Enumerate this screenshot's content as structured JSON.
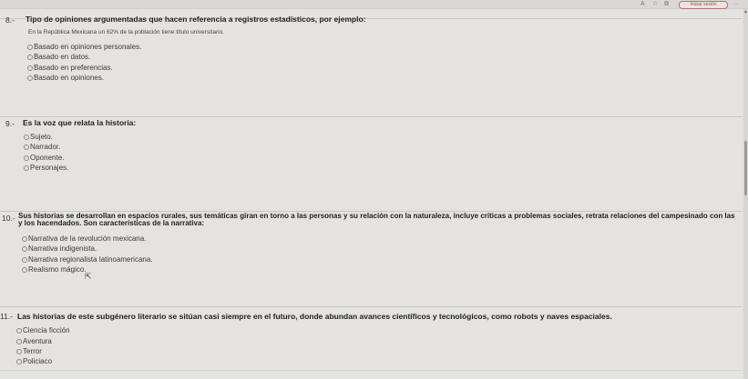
{
  "toolbar": {
    "pill_label": "Iniciar sesión",
    "icons": [
      "text-size-icon",
      "favorite-icon",
      "extension-icon",
      "profile-icon",
      "more-icon"
    ]
  },
  "questions": [
    {
      "number": "8.-",
      "text": "Tipo de opiniones argumentadas que hacen referencia a registros estadísticos, por ejemplo:",
      "note": "En la República Mexicana un 62% de la población tiene título universitario.",
      "options": [
        "Basado en opiniones personales.",
        "Basado en datos.",
        "Basado en preferencias.",
        "Basado en opiniones."
      ]
    },
    {
      "number": "9.-",
      "text": "Es la voz que relata la historia:",
      "options": [
        "Sujeto.",
        "Narrador.",
        "Oponente.",
        "Personajes."
      ]
    },
    {
      "number": "10.-",
      "text_line1": "Sus historias se desarrollan en espacios rurales, sus temáticas giran en torno a las personas y su relación con la naturaleza, incluye críticas a problemas sociales, retrata relaciones del campesinado con las",
      "text_line2": "y los hacendados. Son características de la narrativa:",
      "options": [
        "Narrativa de la revolución mexicana.",
        "Narrativa indigenista.",
        "Narrativa regionalista latinoamericana.",
        "Realismo mágico."
      ]
    },
    {
      "number": "11.-",
      "text": "Las historias de este subgénero literario se sitúan casi siempre en el futuro, donde abundan avances científicos y tecnológicos, como robots y naves espaciales.",
      "options": [
        "Ciencia ficción",
        "Aventura",
        "Terror",
        "Policiaco"
      ]
    }
  ]
}
